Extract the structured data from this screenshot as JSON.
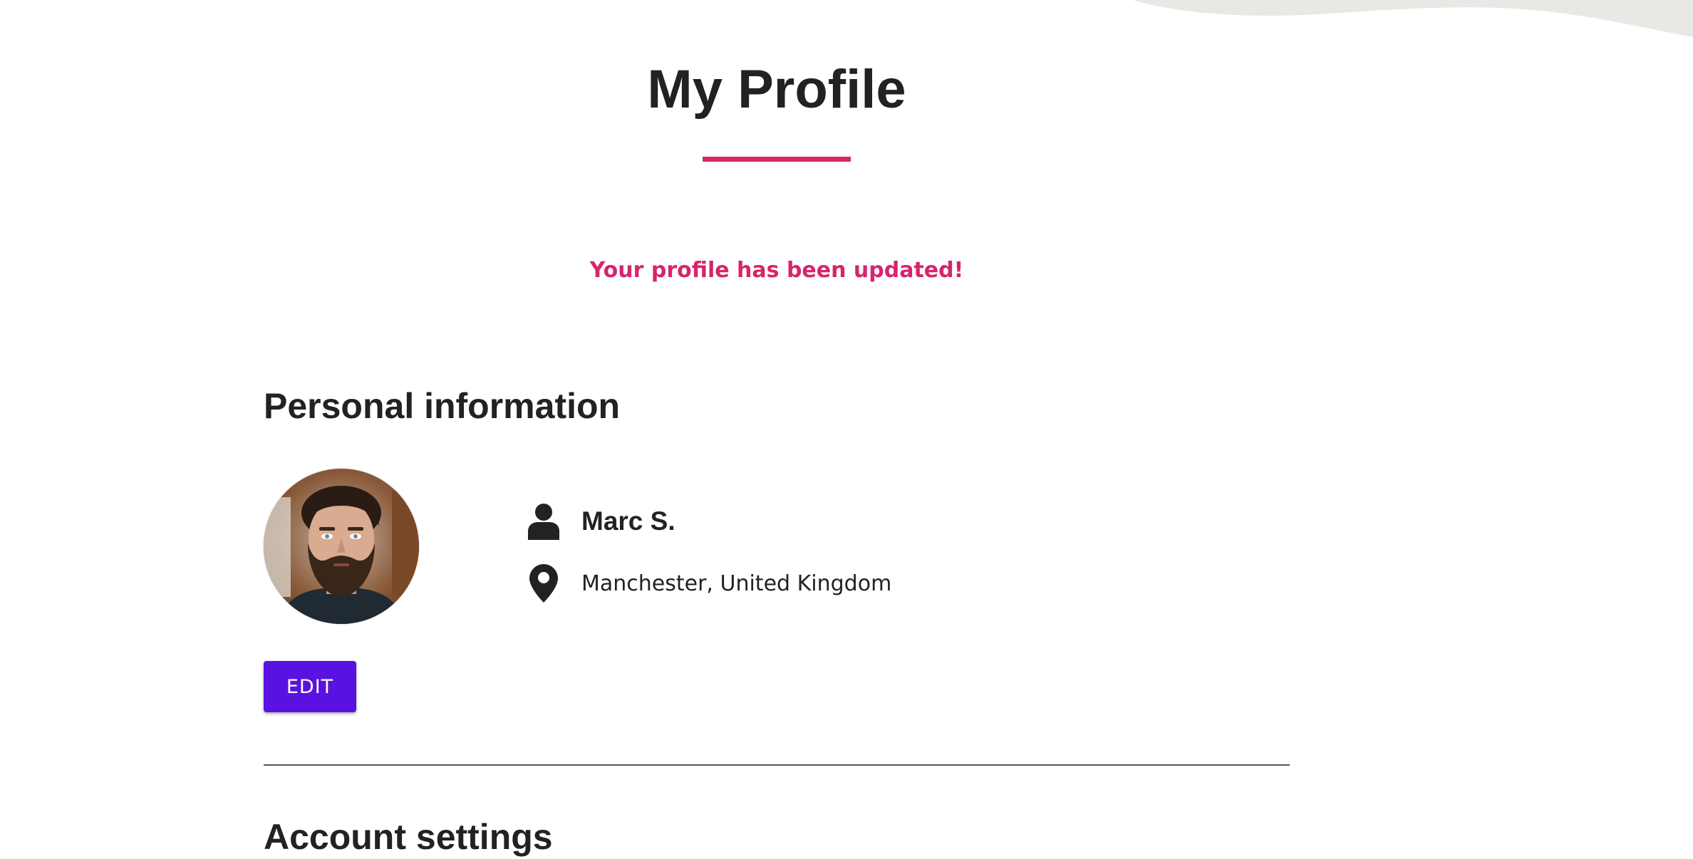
{
  "page": {
    "title": "My Profile",
    "flash_message": "Your profile has been updated!"
  },
  "personal_information": {
    "heading": "Personal information",
    "name": "Marc S.",
    "location": "Manchester, United Kingdom",
    "edit_label": "EDIT"
  },
  "account_settings": {
    "heading": "Account settings"
  },
  "colors": {
    "accent_pink": "#d6256b",
    "button_purple": "#5a12e0",
    "text_dark": "#222222",
    "wave_gray": "#e8e9e4"
  },
  "icons": {
    "name": "user-icon",
    "location": "map-pin-icon"
  }
}
